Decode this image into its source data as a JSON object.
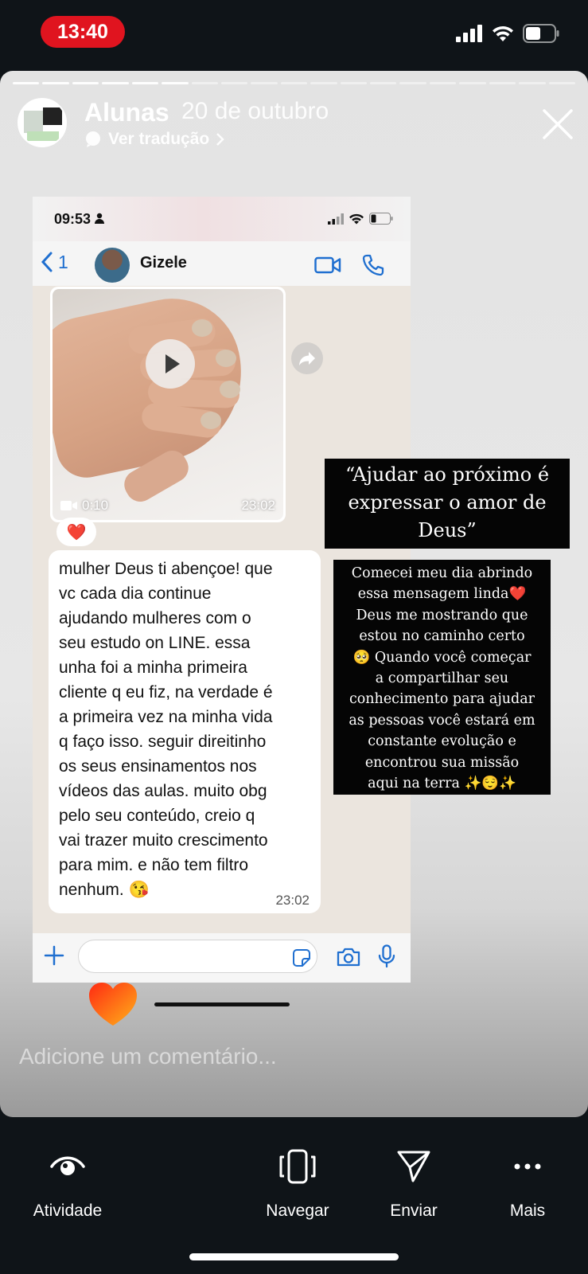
{
  "status_bar": {
    "time": "13:40"
  },
  "story": {
    "account_name": "Alunas",
    "date": "20 de outubro",
    "translate_label": "Ver tradução",
    "progress": {
      "segments_total": 19,
      "segments_viewed": 6
    },
    "comment_placeholder": "Adicione um comentário..."
  },
  "whatsapp": {
    "status_time": "09:53",
    "back_count": "1",
    "contact_name": "Gizele",
    "video": {
      "duration": "0:10",
      "timestamp": "23:02"
    },
    "reaction": "❤️",
    "message": {
      "text": "mulher Deus ti abençoe! que\nvc cada dia continue\najudando mulheres com o\nseu estudo on LINE. essa\nunha foi a minha primeira\ncliente q eu fiz, na verdade é\na primeira vez na minha vida\nq faço isso. seguir direitinho\nos seus ensinamentos nos\nvídeos das aulas. muito obg\npelo seu conteúdo, creio q\nvai trazer muito crescimento\npara mim. e não tem filtro\nnenhum. 😘",
      "timestamp": "23:02"
    }
  },
  "overlays": {
    "quote": "“Ajudar ao próximo é expressar o amor de Deus”",
    "caption": "Comecei meu dia abrindo\nessa mensagem linda❤️\nDeus me mostrando que\nestou no caminho certo\n🥺 Quando você começar\na compartilhar seu\nconhecimento para ajudar\nas pessoas você estará em\nconstante evolução e\nencontrou sua missão\naqui na terra ✨😌✨"
  },
  "bottom_nav": [
    {
      "label": "Atividade",
      "icon": "eye-icon"
    },
    {
      "label": "Navegar",
      "icon": "device-icon"
    },
    {
      "label": "Enviar",
      "icon": "send-icon"
    },
    {
      "label": "Mais",
      "icon": "more-icon"
    }
  ],
  "colors": {
    "time_pill": "#e0141f",
    "nav_background": "#0f1418",
    "whatsapp_blue": "#1f6fd0"
  }
}
